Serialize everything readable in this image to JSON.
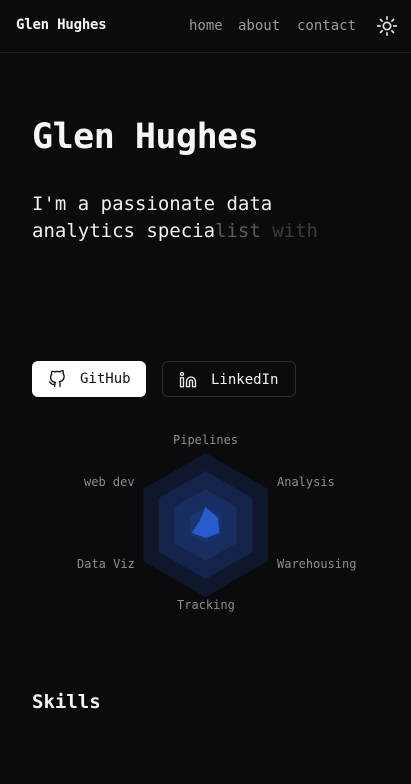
{
  "header": {
    "brand": "Glen Hughes",
    "nav": [
      {
        "label": "home"
      },
      {
        "label": "about"
      },
      {
        "label": "contact"
      }
    ],
    "theme_icon": "sun-icon"
  },
  "hero": {
    "title": "Glen Hughes",
    "intro_line1": "I'm a passionate data",
    "intro_line2_visible": "analytics specia",
    "intro_line2_fading": "list",
    "intro_line2_faded": " with"
  },
  "buttons": {
    "github": {
      "label": "GitHub",
      "icon": "github-icon"
    },
    "linkedin": {
      "label": "LinkedIn",
      "icon": "linkedin-icon"
    }
  },
  "radar": {
    "axes": [
      "Pipelines",
      "Analysis",
      "Warehousing",
      "Tracking",
      "Data Viz",
      "web dev"
    ],
    "levels": 4,
    "colors": {
      "ring": "#1e3b80",
      "fill": "#2a5fd6",
      "background": "#0b0b0d"
    }
  },
  "skills": {
    "heading": "Skills"
  }
}
